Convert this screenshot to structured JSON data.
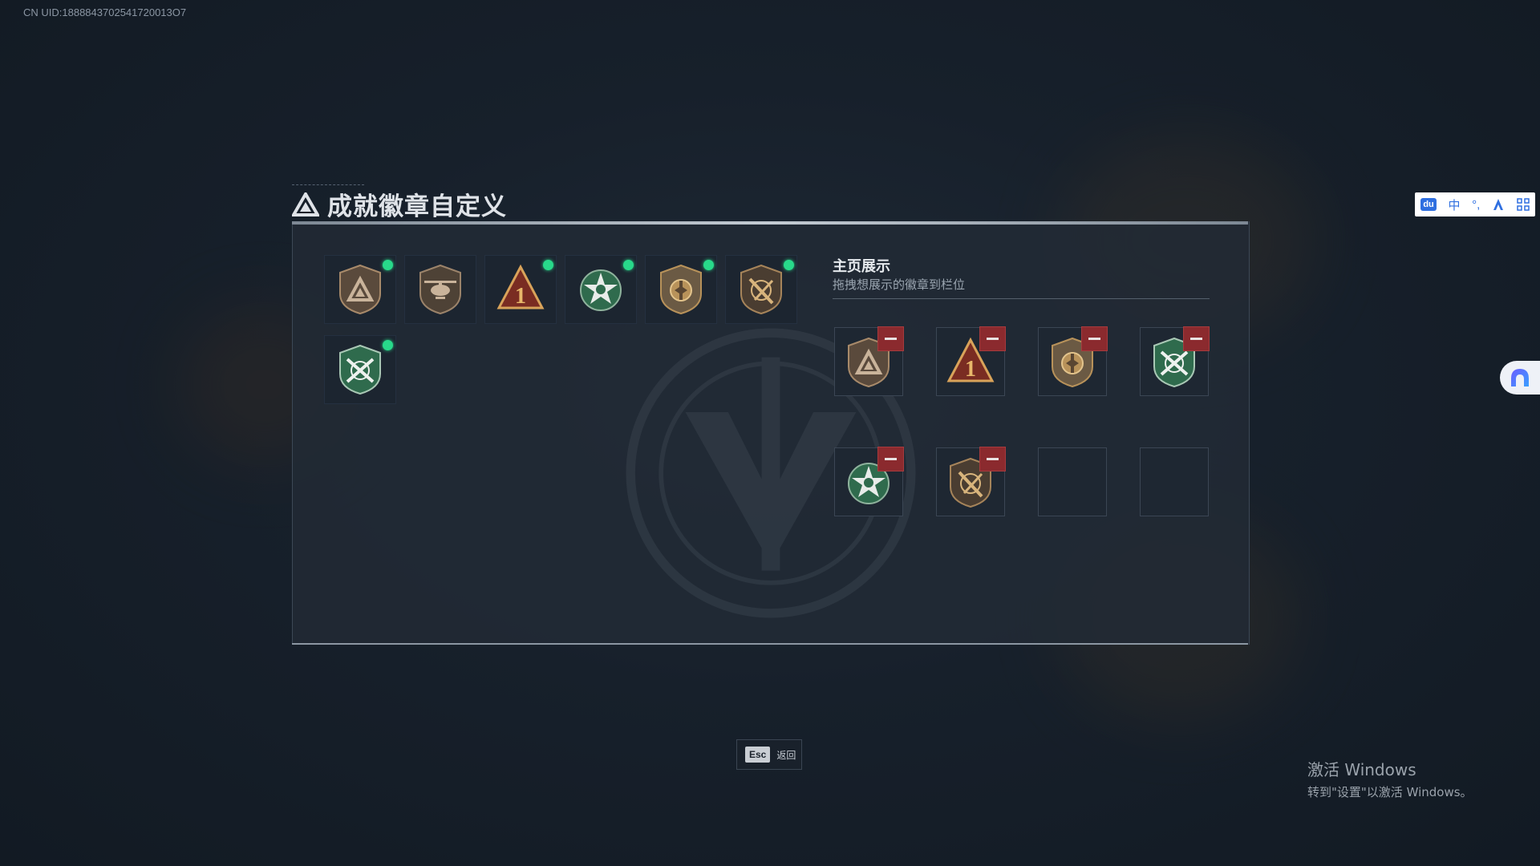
{
  "uid": "CN UID:1888843702541720013O7",
  "title": "成就徽章自定义",
  "owned_badges": [
    {
      "icon": "triangle-shield-badge-icon",
      "is_new": true
    },
    {
      "icon": "helicopter-badge-icon",
      "is_new": false
    },
    {
      "icon": "number-one-triangle-badge-icon",
      "is_new": true
    },
    {
      "icon": "green-star-wreath-badge-icon",
      "is_new": true
    },
    {
      "icon": "gold-emblem-shield-badge-icon",
      "is_new": true
    },
    {
      "icon": "crossed-weapon-shield-badge-icon",
      "is_new": true
    },
    {
      "icon": "green-crossed-rifles-badge-icon",
      "is_new": true
    }
  ],
  "showcase": {
    "title": "主页展示",
    "subtitle": "拖拽想展示的徽章到栏位",
    "slots": [
      {
        "icon": "triangle-shield-badge-icon",
        "filled": true
      },
      {
        "icon": "number-one-triangle-badge-icon",
        "filled": true
      },
      {
        "icon": "gold-emblem-shield-badge-icon",
        "filled": true
      },
      {
        "icon": "green-crossed-rifles-badge-icon",
        "filled": true
      },
      {
        "icon": "green-star-wreath-badge-icon",
        "filled": true
      },
      {
        "icon": "crossed-weapon-shield-badge-icon",
        "filled": true
      },
      {
        "icon": "",
        "filled": false
      },
      {
        "icon": "",
        "filled": false
      }
    ]
  },
  "footer": {
    "key": "Esc",
    "label": "返回"
  },
  "ime": {
    "logo": "du",
    "mode": "中",
    "punct": "°,"
  },
  "windows_activation": {
    "title": "激活 Windows",
    "subtitle": "转到\"设置\"以激活 Windows。"
  },
  "colors": {
    "new_dot": "#28d98a",
    "remove": "#8b2a2e",
    "accent_gold": "#b8925a",
    "accent_green": "#2f6b4d"
  }
}
